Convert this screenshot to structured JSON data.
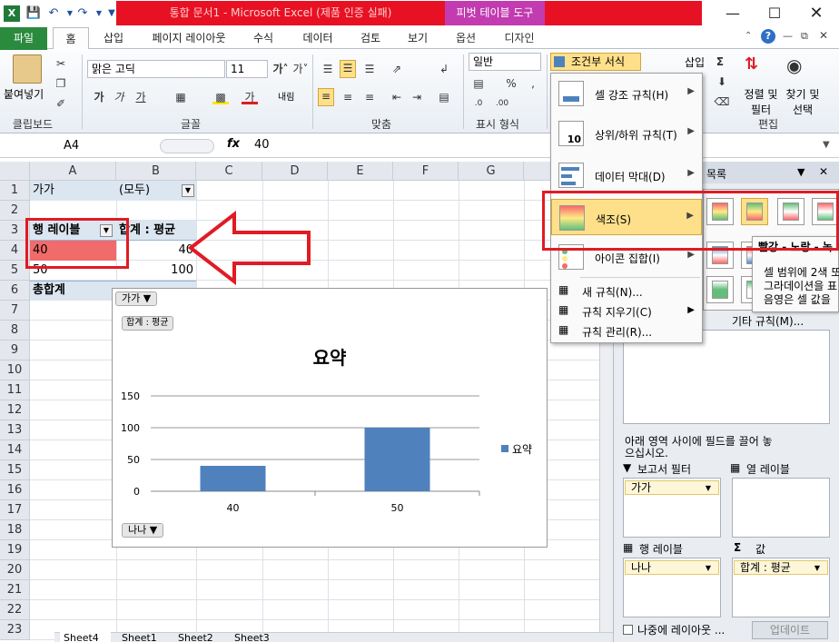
{
  "window": {
    "title": "통합 문서1 - Microsoft Excel (제품 인증 실패)",
    "contextual_tab": "피벗 테이블 도구"
  },
  "tabs": [
    "파일",
    "홈",
    "삽입",
    "페이지 레이아웃",
    "수식",
    "데이터",
    "검토",
    "보기",
    "옵션",
    "디자인"
  ],
  "ribbon": {
    "paste_label": "붙여넣기",
    "clipboard_label": "클립보드",
    "font_name": "맑은 고딕",
    "font_size": "11",
    "font_group": "글꼴",
    "align_group": "맞춤",
    "number_format": "일반",
    "number_group": "표시 형식",
    "cond_format_label": "조건부 서식",
    "insert_label": "삽입",
    "sort_filter_label": "정렬 및 필터",
    "find_select_label": "찾기 및 선택",
    "edit_group": "편집",
    "wrap_label": "내림"
  },
  "formula_bar": {
    "name_box": "A4",
    "fx": "fx",
    "value": "40"
  },
  "grid": {
    "columns": [
      "A",
      "B",
      "C",
      "D",
      "E",
      "F",
      "G"
    ],
    "rows": [
      "1",
      "2",
      "3",
      "4",
      "5",
      "6",
      "7",
      "8",
      "9",
      "10",
      "11",
      "12",
      "13",
      "14",
      "15",
      "16",
      "17",
      "18",
      "19",
      "20",
      "21",
      "22",
      "23"
    ],
    "a1": "가가",
    "b1": "(모두)",
    "a3": "행 레이블",
    "b3": "합계 : 평균",
    "a4": "40",
    "b4": "40",
    "a5": "50",
    "b5": "100",
    "a6": "총합계"
  },
  "sheet_tabs": [
    "Sheet4",
    "Sheet1",
    "Sheet2",
    "Sheet3"
  ],
  "chart_data": {
    "type": "bar",
    "title": "요약",
    "categories": [
      "40",
      "50"
    ],
    "series": [
      {
        "name": "요약",
        "values": [
          40,
          100
        ]
      }
    ],
    "ylim": [
      0,
      150
    ],
    "yticks": [
      "0",
      "50",
      "100",
      "150"
    ],
    "legend": "right",
    "grid": true,
    "color": "#4f81bd",
    "filter_button": "가가",
    "value_button": "합계 : 평균",
    "axis_button": "나나"
  },
  "cond_menu": {
    "items": [
      "셀 강조 규칙(H)",
      "상위/하위 규칙(T)",
      "데이터 막대(D)",
      "색조(S)",
      "아이콘 집합(I)"
    ],
    "small_items": [
      "새 규칙(N)...",
      "규칙 지우기(C)",
      "규칙 관리(R)..."
    ],
    "more_rules": "기타 규칙(M)..."
  },
  "tooltip": {
    "title": "빨강 - 노랑 - 녹",
    "lines": [
      "셀 범위에 2색 또",
      "그라데이션을 표",
      "음영은 셀 값을"
    ]
  },
  "pane": {
    "title": "목록",
    "drag_hint": "아래 영역 사이에 필드를 끌어 놓으십시오.",
    "report_filter": "보고서 필터",
    "col_labels": "열 레이블",
    "row_labels": "행 레이블",
    "values": "값",
    "filter_chip": "가가",
    "row_chip": "나나",
    "value_chip": "합계 : 평균",
    "defer_label": "나중에 레이아웃 ...",
    "update_button": "업데이트"
  },
  "colors": {
    "accent_red": "#e01b24",
    "excel_green": "#2a8a3e",
    "pivot_magenta": "#c23bb0",
    "bar_blue": "#4f81bd"
  }
}
